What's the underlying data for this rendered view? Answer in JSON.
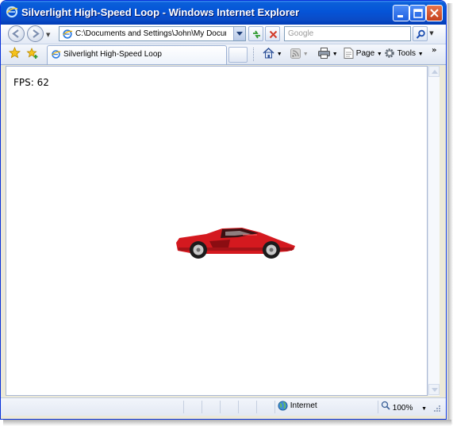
{
  "window": {
    "title": "Silverlight High-Speed Loop - Windows Internet Explorer"
  },
  "navigation": {
    "back_icon": "back-arrow-icon",
    "forward_icon": "forward-arrow-icon",
    "address": "C:\\Documents and Settings\\John\\My Documents\\Vis",
    "search_placeholder": "Google"
  },
  "tabs": [
    {
      "label": "Silverlight High-Speed Loop",
      "icon": "ie-page-icon"
    }
  ],
  "command_bar": {
    "page_label": "Page",
    "tools_label": "Tools"
  },
  "content": {
    "fps_text": "FPS: 62",
    "car_colors": {
      "body": "#d4191f",
      "shadow": "#8b0d12",
      "tire": "#1c1c1c",
      "rim": "#c9c9c9"
    }
  },
  "status_bar": {
    "zone": "Internet",
    "zoom": "100%"
  },
  "colors": {
    "titlebar": "#0a5fd9",
    "accent": "#3c8cf3"
  }
}
